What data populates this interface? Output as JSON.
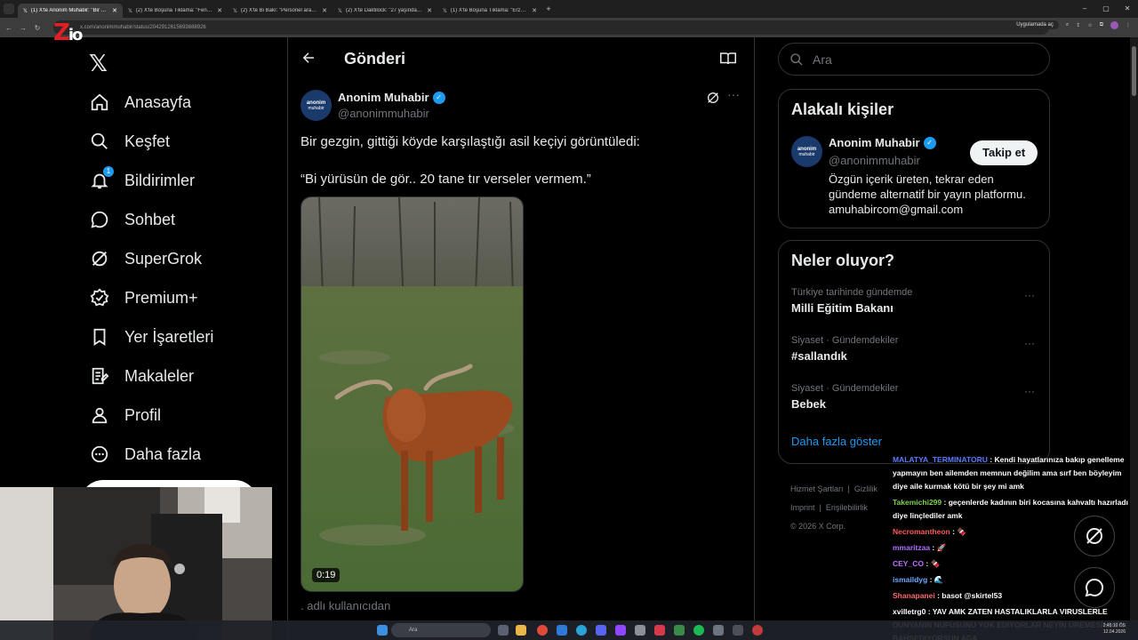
{
  "browser": {
    "tabs": [
      {
        "title": "(1) X'te Anonim Muhabir: \"Bir gezgin...",
        "active": true
      },
      {
        "title": "(2) X'te Boşuna Tıklama: \"Fenomen...",
        "active": false
      },
      {
        "title": "(2) X'te Bi Bakî: \"Personel arasın...",
        "active": false
      },
      {
        "title": "(2) X'te Daktilock: \"27 yaşındayım...",
        "active": false
      },
      {
        "title": "(1) X'te Boşuna Tıklama: \"Erzurum...",
        "active": false
      }
    ],
    "url": "x.com/anonimmuhabir/status/2042912615693688926",
    "open_in_app": "Uygulamada aç"
  },
  "overlay_logo": {
    "main": "Z",
    "sub": "io"
  },
  "nav": {
    "items": [
      {
        "label": "Anasayfa",
        "icon": "home-icon"
      },
      {
        "label": "Keşfet",
        "icon": "search-icon"
      },
      {
        "label": "Bildirimler",
        "icon": "bell-icon",
        "badge": "1"
      },
      {
        "label": "Sohbet",
        "icon": "chat-icon"
      },
      {
        "label": "SuperGrok",
        "icon": "grok-icon"
      },
      {
        "label": "Premium+",
        "icon": "verified-icon"
      },
      {
        "label": "Yer İşaretleri",
        "icon": "bookmark-icon"
      },
      {
        "label": "Makaleler",
        "icon": "article-icon"
      },
      {
        "label": "Profil",
        "icon": "person-icon"
      },
      {
        "label": "Daha fazla",
        "icon": "more-circle-icon"
      }
    ]
  },
  "post": {
    "header_title": "Gönderi",
    "author_name": "Anonim Muhabir",
    "author_handle": "@anonimmuhabir",
    "avatar_text": "anonim",
    "avatar_subtext": "muhabir",
    "text": "Bir gezgin, gittiği köyde karşılaştığı asil keçiyi görüntüledi:",
    "quote": "“Bi yürüsün de gör.. 20 tane tır verseler vermem.”",
    "video_duration": "0:19",
    "below_text": ". adlı kullanıcıdan"
  },
  "search": {
    "placeholder": "Ara"
  },
  "related": {
    "title": "Alakalı kişiler",
    "name": "Anonim Muhabir",
    "handle": "@anonimmuhabir",
    "bio": "Özgün içerik üreten, tekrar eden gündeme alternatif bir yayın platformu. amuhabircom@gmail.com",
    "follow_label": "Takip et"
  },
  "trends": {
    "title": "Neler oluyor?",
    "items": [
      {
        "context": "Türkiye tarihinde gündemde",
        "topic": "Milli Eğitim Bakanı"
      },
      {
        "context": "Siyaset · Gündemdekiler",
        "topic": "#sallandık"
      },
      {
        "context": "Siyaset · Gündemdekiler",
        "topic": "Bebek"
      }
    ],
    "show_more": "Daha fazla göster"
  },
  "footer": {
    "links": [
      "Hizmet Şartları",
      "Gizlilik",
      "Imprint",
      "Erişilebilirlik"
    ],
    "copyright": "© 2026 X Corp."
  },
  "chat": [
    {
      "user": "MALATYA_TERMINATORU",
      "color": "#5b7cff",
      "message": "Kendi hayatlarınıza bakıp genelleme yapmayın ben ailemden memnun değilim ama sırf ben böyleyim diye aile kurmak kötü bir şey mi amk"
    },
    {
      "user": "Takemichi299",
      "color": "#7fd14b",
      "message": "geçenlerde kadının biri kocasına kahvaltı hazırladı diye linçlediler amk"
    },
    {
      "user": "Necromantheon",
      "color": "#ff5a5a",
      "message": "🍫"
    },
    {
      "user": "mmaritzaa",
      "color": "#b070ff",
      "message": "🚀"
    },
    {
      "user": "CEY_CO",
      "color": "#c070ff",
      "message": "🍫"
    },
    {
      "user": "ismaildyg",
      "color": "#6fa8ff",
      "message": "🌊"
    },
    {
      "user": "Shanapanei",
      "color": "#ff6a6a",
      "message": "basot @skirtel53"
    },
    {
      "user": "xvilletrg0",
      "color": "#ffffff",
      "message": "YAV AMK ZATEN HASTALIKLARLA VIRUSLERLE DUNYANIN NUFUSUNU YOK EDIYORLAR NEYİN ÜREMESİNDEN BAHSEDIYORSUN AGA"
    }
  ],
  "taskbar": {
    "search": "Ara",
    "time": "2:45:10 ÖS",
    "date": "12.04.2026"
  },
  "colors": {
    "accent": "#1d9bf0",
    "background": "#000000",
    "border": "#2f3336",
    "muted": "#71767b"
  }
}
